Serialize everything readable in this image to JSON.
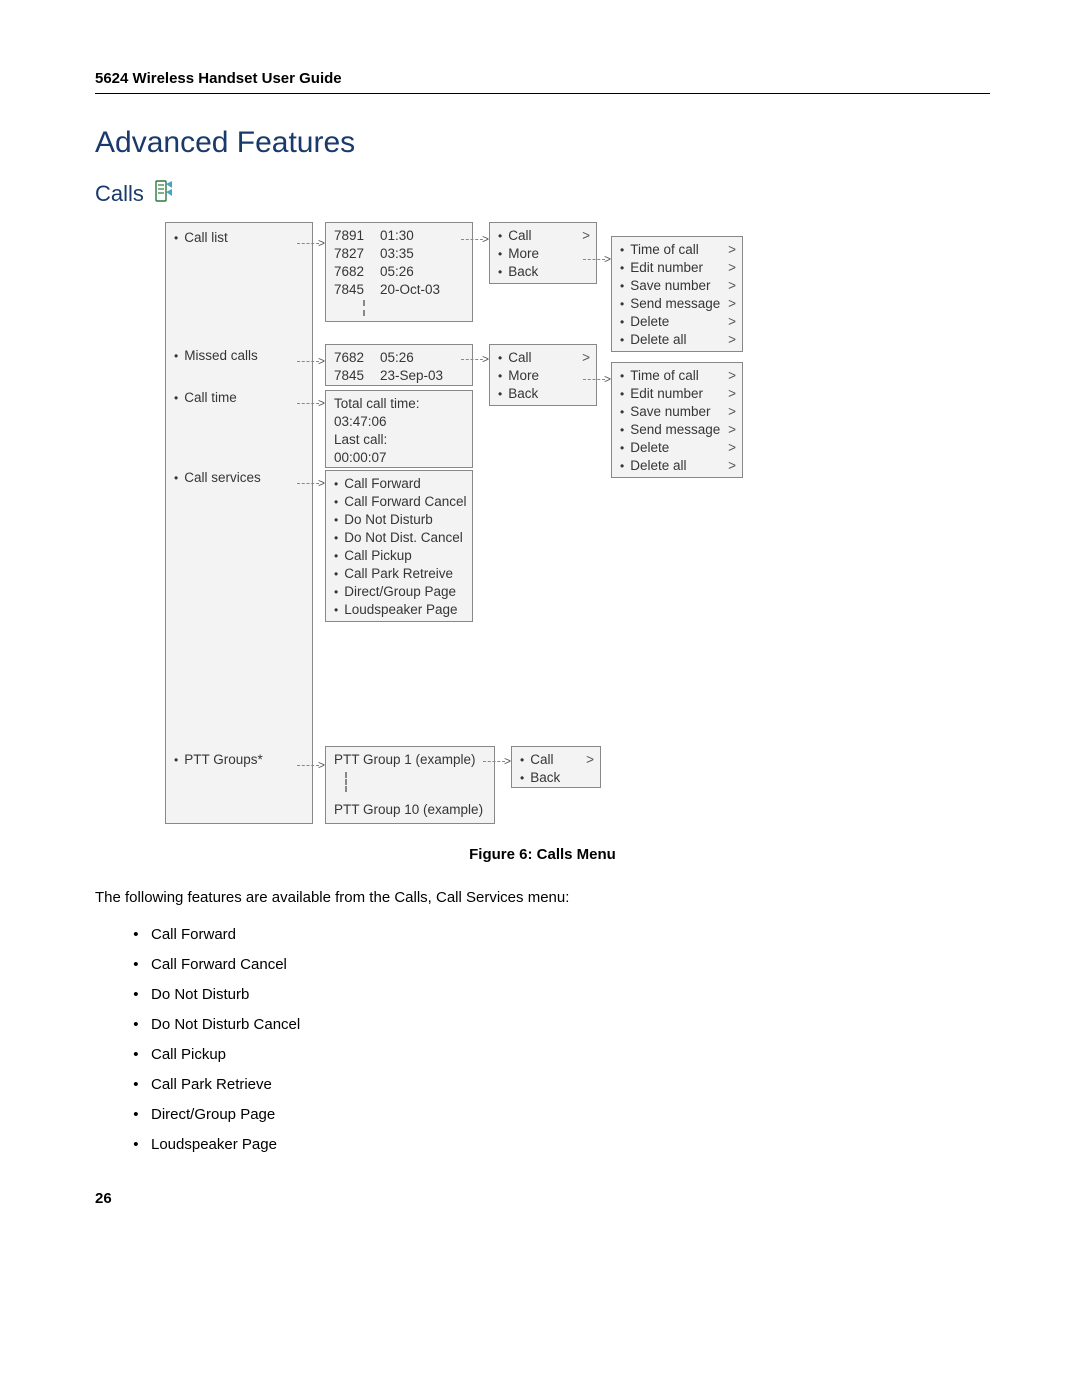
{
  "header": "5624 Wireless Handset User Guide",
  "heading1": "Advanced Features",
  "heading2": "Calls",
  "col1": {
    "i0": "Call list",
    "i1": "Missed calls",
    "i2": "Call time",
    "i3": "Call services",
    "i4": "PTT Groups*"
  },
  "call_list_box": {
    "r0a": "7891",
    "r0b": "01:30",
    "r1a": "7827",
    "r1b": "03:35",
    "r2a": "7682",
    "r2b": "05:26",
    "r3a": "7845",
    "r3b": "20-Oct-03"
  },
  "missed_box": {
    "r0a": "7682",
    "r0b": "05:26",
    "r1a": "7845",
    "r1b": "23-Sep-03"
  },
  "calltime_box": {
    "l0": "Total call time:",
    "l1": "03:47:06",
    "l2": "Last call:",
    "l3": "00:00:07"
  },
  "services_box": {
    "s0": "Call Forward",
    "s1": "Call Forward Cancel",
    "s2": "Do Not Disturb",
    "s3": "Do Not Dist. Cancel",
    "s4": "Call Pickup",
    "s5": "Call Park Retreive",
    "s6": "Direct/Group Page",
    "s7": "Loudspeaker Page"
  },
  "ptt_box": {
    "p0": "PTT Group 1 (example)",
    "p1": "PTT Group 10 (example)"
  },
  "sub3": {
    "c0": "Call",
    "c1": "More",
    "c2": "Back"
  },
  "sub2": {
    "c0": "Call",
    "c1": "Back"
  },
  "more_box": {
    "m0": "Time of call",
    "m1": "Edit number",
    "m2": "Save number",
    "m3": "Send message",
    "m4": "Delete",
    "m5": "Delete all"
  },
  "figure_caption": "Figure 6: Calls Menu",
  "body_text": "The following features are available from the Calls, Call Services menu:",
  "features": {
    "f0": "Call Forward",
    "f1": "Call Forward Cancel",
    "f2": "Do Not Disturb",
    "f3": "Do Not Disturb Cancel",
    "f4": "Call Pickup",
    "f5": "Call Park Retrieve",
    "f6": "Direct/Group Page",
    "f7": "Loudspeaker Page"
  },
  "page_number": "26"
}
